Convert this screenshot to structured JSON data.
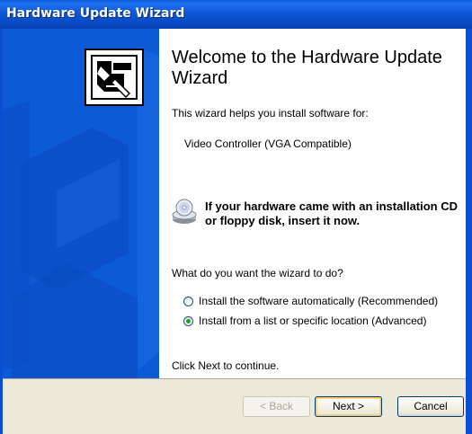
{
  "window": {
    "title": "Hardware Update Wizard"
  },
  "content": {
    "heading": "Welcome to the Hardware Update Wizard",
    "intro": "This wizard helps you install software for:",
    "device_name": "Video Controller (VGA Compatible)",
    "cd_prompt_line1": "If your hardware came with an installation CD",
    "cd_prompt_line2": "or floppy disk, insert it now.",
    "question": "What do you want the wizard to do?",
    "options": [
      {
        "label": "Install the software automatically (Recommended)",
        "selected": false
      },
      {
        "label": "Install from a list or specific location (Advanced)",
        "selected": true
      }
    ],
    "continue_hint": "Click Next to continue."
  },
  "buttons": {
    "back": "< Back",
    "next": "Next >",
    "cancel": "Cancel"
  }
}
